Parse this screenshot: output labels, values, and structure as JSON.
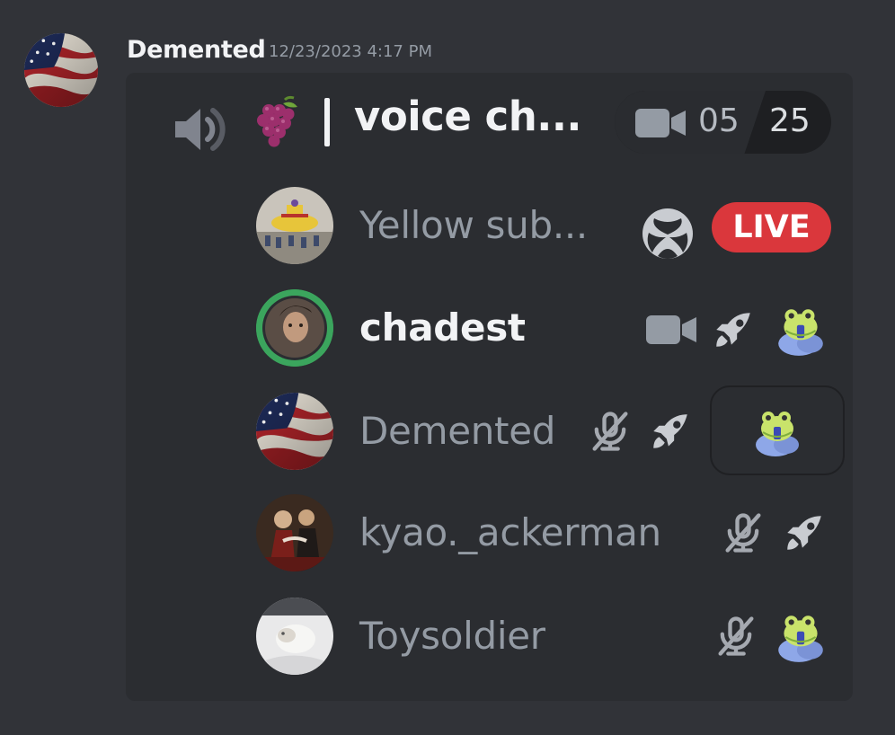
{
  "message": {
    "author": "Demented",
    "timestamp": "12/23/2023 4:17 PM"
  },
  "voice_channel": {
    "name": "voice ch...",
    "channel_emoji": "grape-icon",
    "current_count": "05",
    "user_limit": "25"
  },
  "members": [
    {
      "name": "Yellow sub...",
      "activity": "xbox-icon",
      "badge": "LIVE"
    },
    {
      "name": "chadest",
      "speaking": true,
      "icons": [
        "video-icon",
        "boost-rocket-icon",
        "frog-emoji-icon"
      ]
    },
    {
      "name": "Demented",
      "icons": [
        "muted-mic-icon",
        "boost-rocket-icon",
        "frog-emoji-icon"
      ]
    },
    {
      "name": "kyao._ackerman",
      "icons": [
        "muted-mic-icon",
        "boost-rocket-icon"
      ]
    },
    {
      "name": "Toysoldier",
      "icons": [
        "muted-mic-icon",
        "frog-emoji-icon"
      ]
    }
  ],
  "colors": {
    "background": "#313338",
    "card": "#2b2d31",
    "live_red": "#da373c",
    "speaking_green": "#3ba55d",
    "muted_text": "#949ba4"
  }
}
